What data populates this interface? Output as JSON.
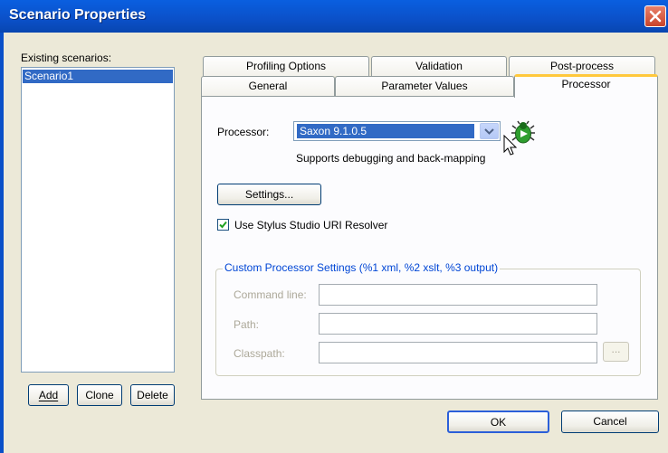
{
  "window": {
    "title": "Scenario Properties"
  },
  "scenarios": {
    "label": "Existing scenarios:",
    "items": [
      "Scenario1"
    ],
    "add": "Add",
    "clone": "Clone",
    "delete": "Delete"
  },
  "tabs": {
    "row1": [
      "Profiling Options",
      "Validation",
      "Post-process"
    ],
    "row2": [
      "General",
      "Parameter Values",
      "Processor"
    ],
    "active": "Processor"
  },
  "processor": {
    "label": "Processor:",
    "value": "Saxon 9.1.0.5",
    "note": "Supports debugging and back-mapping",
    "settings_button": "Settings...",
    "resolver_checkbox": {
      "label": "Use Stylus Studio URI Resolver",
      "checked": true
    }
  },
  "custom": {
    "title": "Custom Processor Settings (%1 xml, %2 xslt, %3 output)",
    "command_line": {
      "label": "Command line:",
      "value": ""
    },
    "path": {
      "label": "Path:",
      "value": ""
    },
    "classpath": {
      "label": "Classpath:",
      "value": ""
    },
    "browse": "..."
  },
  "footer": {
    "ok": "OK",
    "cancel": "Cancel"
  }
}
